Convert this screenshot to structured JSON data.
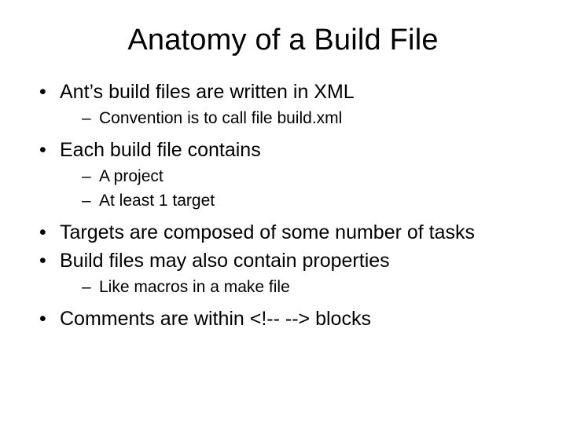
{
  "title": "Anatomy of a Build File",
  "bullets": [
    {
      "text": "Ant’s build files are written in XML",
      "sub": [
        "Convention is to call file build.xml"
      ]
    },
    {
      "text": "Each build file contains",
      "sub": [
        "A project",
        "At least 1 target"
      ]
    },
    {
      "text": "Targets are composed of some number of tasks",
      "sub": []
    },
    {
      "text": "Build files may also contain properties",
      "sub": [
        "Like macros in a make file"
      ]
    },
    {
      "text": "Comments are within <!-- --> blocks",
      "sub": []
    }
  ]
}
